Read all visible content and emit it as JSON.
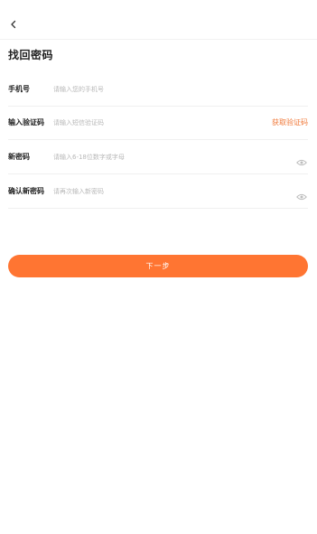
{
  "header": {
    "back_icon": "chevron-left-icon",
    "title": "找回密码"
  },
  "form": {
    "phone": {
      "label": "手机号",
      "placeholder": "请输入您的手机号",
      "value": ""
    },
    "code": {
      "label": "输入验证码",
      "placeholder": "请输入短信验证码",
      "value": "",
      "get_code_label": "获取验证码"
    },
    "new_password": {
      "label": "新密码",
      "placeholder": "请输入6-18位数字或字母",
      "value": "",
      "toggle_icon": "eye-icon"
    },
    "confirm_password": {
      "label": "确认新密码",
      "placeholder": "请再次输入新密码",
      "value": "",
      "toggle_icon": "eye-icon"
    }
  },
  "actions": {
    "next_label": "下一步"
  },
  "colors": {
    "accent": "#ff7532",
    "link": "#f07838",
    "placeholder": "#b8b8b8",
    "divider": "#f0f0f0"
  }
}
